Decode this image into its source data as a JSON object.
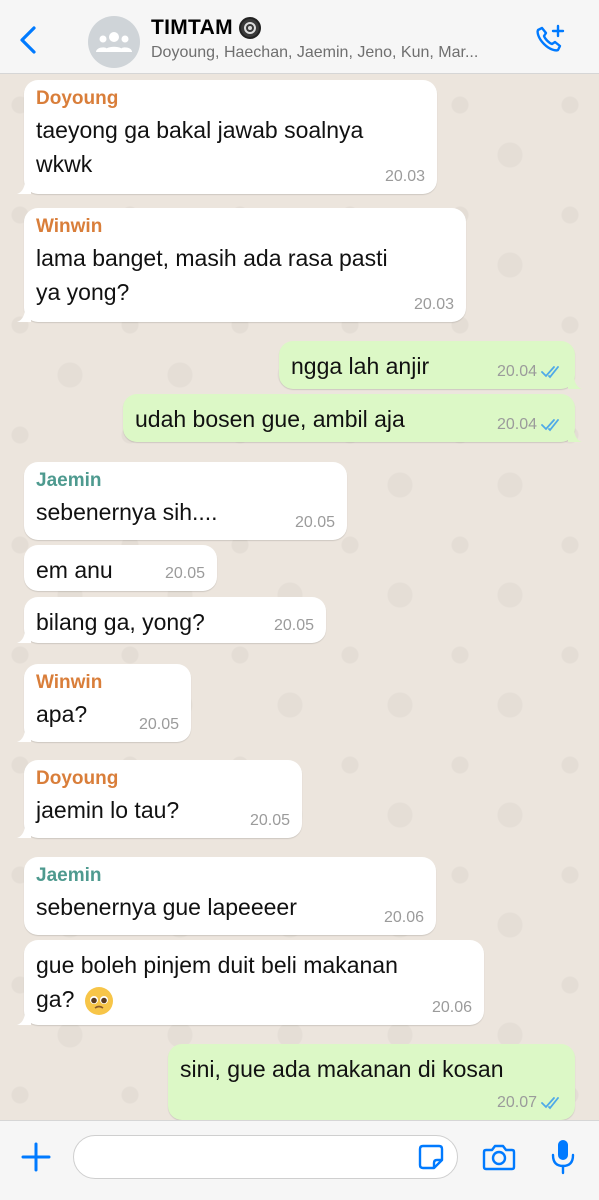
{
  "header": {
    "title": "TIMTAM",
    "members": "Doyoung, Haechan, Jaemin, Jeno, Kun, Mar..."
  },
  "colors": {
    "accent": "#007AFF",
    "outgoing": "#DCF8C6",
    "incoming": "#FFFFFF",
    "sender_doyoung": "#D97E3A",
    "sender_winwin": "#D97E3A",
    "sender_jaemin": "#4E9A8F",
    "read_ticks": "#4FA9E8"
  },
  "messages": [
    {
      "sender": "Doyoung",
      "text_lines": [
        "taeyong ga bakal jawab soalnya",
        "wkwk"
      ],
      "time": "20.03"
    },
    {
      "sender": "Winwin",
      "text_lines": [
        "lama banget, masih ada rasa pasti",
        "ya yong?"
      ],
      "time": "20.03"
    },
    {
      "text_lines": [
        "ngga lah anjir"
      ],
      "time": "20.04"
    },
    {
      "text_lines": [
        "udah bosen gue, ambil aja"
      ],
      "time": "20.04"
    },
    {
      "sender": "Jaemin",
      "text_lines": [
        "sebenernya sih...."
      ],
      "time": "20.05"
    },
    {
      "text_lines": [
        "em anu"
      ],
      "time": "20.05"
    },
    {
      "text_lines": [
        "bilang ga, yong?"
      ],
      "time": "20.05"
    },
    {
      "sender": "Winwin",
      "text_lines": [
        "apa?"
      ],
      "time": "20.05"
    },
    {
      "sender": "Doyoung",
      "text_lines": [
        "jaemin lo tau?"
      ],
      "time": "20.05"
    },
    {
      "sender": "Jaemin",
      "text_lines": [
        "sebenernya gue lapeeeer"
      ],
      "time": "20.06"
    },
    {
      "text_lines": [
        "gue boleh pinjem duit beli makanan",
        "ga?"
      ],
      "time": "20.06"
    },
    {
      "text_lines": [
        "sini, gue ada makanan di kosan"
      ],
      "time": "20.07"
    }
  ],
  "input": {
    "placeholder": ""
  },
  "icons": {
    "back": "chevron-left-icon",
    "avatar": "group-avatar-icon",
    "call": "add-call-icon",
    "plus": "plus-icon",
    "sticker": "sticker-icon",
    "camera": "camera-icon",
    "mic": "microphone-icon"
  }
}
